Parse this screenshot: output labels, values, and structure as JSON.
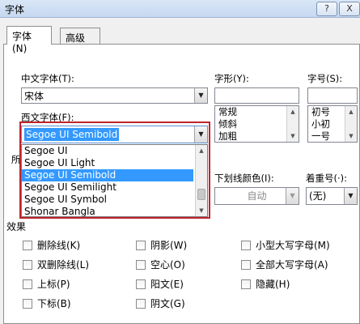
{
  "window": {
    "title": "字体",
    "help_label": "?",
    "close_label": "X"
  },
  "tabs": [
    {
      "label": "字体(N)"
    },
    {
      "label": "高级(V)"
    }
  ],
  "chinese_font": {
    "label": "中文字体(T):",
    "value": "宋体"
  },
  "font_style": {
    "label": "字形(Y):",
    "value": "",
    "items": [
      "常规",
      "倾斜",
      "加粗"
    ]
  },
  "font_size": {
    "label": "字号(S):",
    "value": "",
    "items": [
      "初号",
      "小初",
      "一号"
    ]
  },
  "western_font": {
    "label": "西文字体(F):",
    "value": "Segoe UI Semibold",
    "dropdown_items": [
      {
        "label": "Segoe UI",
        "selected": false
      },
      {
        "label": "Segoe UI Light",
        "selected": false
      },
      {
        "label": "Segoe UI Semibold",
        "selected": true
      },
      {
        "label": "Segoe UI Semilight",
        "selected": false
      },
      {
        "label": "Segoe UI Symbol",
        "selected": false
      },
      {
        "label": "Shonar Bangla",
        "selected": false
      }
    ]
  },
  "all_text_label_partial": "所",
  "underline_color": {
    "label": "下划线颜色(I):",
    "value": "自动"
  },
  "emphasis": {
    "label": "着重号(·):",
    "value": "(无)"
  },
  "effects": {
    "title": "效果",
    "items": [
      {
        "label": "删除线(K)"
      },
      {
        "label": "双删除线(L)"
      },
      {
        "label": "上标(P)"
      },
      {
        "label": "下标(B)"
      },
      {
        "label": "阴影(W)"
      },
      {
        "label": "空心(O)"
      },
      {
        "label": "阳文(E)"
      },
      {
        "label": "阴文(G)"
      },
      {
        "label": "小型大写字母(M)"
      },
      {
        "label": "全部大写字母(A)"
      },
      {
        "label": "隐藏(H)"
      }
    ]
  },
  "icons": {
    "dropdown": "chevron-down-icon",
    "scroll_up": "scroll-up-icon",
    "scroll_down": "scroll-down-icon"
  },
  "colors": {
    "highlight_border": "#c0232b",
    "selection": "#3399ff"
  }
}
